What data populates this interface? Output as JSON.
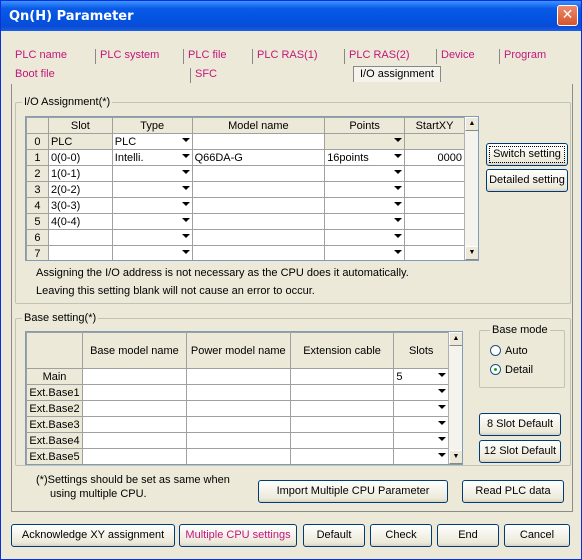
{
  "window": {
    "title": "Qn(H) Parameter",
    "close_glyph": "✕"
  },
  "tabs": {
    "row1": [
      "PLC name",
      "PLC system",
      "PLC file",
      "PLC RAS(1)",
      "PLC RAS(2)",
      "Device",
      "Program"
    ],
    "row2": [
      "Boot file",
      "SFC",
      "I/O assignment"
    ],
    "selected": "I/O assignment"
  },
  "io": {
    "legend": "I/O Assignment(*)",
    "headers": [
      "Slot",
      "Type",
      "Model name",
      "Points",
      "StartXY"
    ],
    "rows": [
      {
        "no": "0",
        "slot": "PLC",
        "type": "PLC",
        "model": "",
        "points": "",
        "start": ""
      },
      {
        "no": "1",
        "slot": "0(0-0)",
        "type": "Intelli.",
        "model": "Q66DA-G",
        "points": "16points",
        "start": "0000"
      },
      {
        "no": "2",
        "slot": "1(0-1)",
        "type": "",
        "model": "",
        "points": "",
        "start": ""
      },
      {
        "no": "3",
        "slot": "2(0-2)",
        "type": "",
        "model": "",
        "points": "",
        "start": ""
      },
      {
        "no": "4",
        "slot": "3(0-3)",
        "type": "",
        "model": "",
        "points": "",
        "start": ""
      },
      {
        "no": "5",
        "slot": "4(0-4)",
        "type": "",
        "model": "",
        "points": "",
        "start": ""
      },
      {
        "no": "6",
        "slot": "",
        "type": "",
        "model": "",
        "points": "",
        "start": ""
      },
      {
        "no": "7",
        "slot": "",
        "type": "",
        "model": "",
        "points": "",
        "start": ""
      }
    ],
    "note1": "Assigning the I/O address is not necessary as the CPU does it automatically.",
    "note2": "Leaving this setting blank will not cause an error to occur.",
    "switch_btn": "Switch setting",
    "detailed_btn": "Detailed setting"
  },
  "base": {
    "legend": "Base setting(*)",
    "headers": [
      "Base model name",
      "Power model name",
      "Extension cable",
      "Slots"
    ],
    "rows": [
      {
        "name": "Main",
        "slots": "5"
      },
      {
        "name": "Ext.Base1",
        "slots": ""
      },
      {
        "name": "Ext.Base2",
        "slots": ""
      },
      {
        "name": "Ext.Base3",
        "slots": ""
      },
      {
        "name": "Ext.Base4",
        "slots": ""
      },
      {
        "name": "Ext.Base5",
        "slots": ""
      }
    ],
    "mode_legend": "Base mode",
    "mode_auto": "Auto",
    "mode_detail": "Detail",
    "selected_mode": "Detail",
    "slot8_btn": "8 Slot Default",
    "slot12_btn": "12 Slot Default"
  },
  "footnote": {
    "line1": "(*)Settings should be set as same when",
    "line2": "using multiple CPU."
  },
  "mid_buttons": {
    "import": "Import Multiple CPU Parameter",
    "read": "Read PLC data"
  },
  "bottom_buttons": {
    "ack": "Acknowledge XY assignment",
    "multi": "Multiple CPU settings",
    "default": "Default",
    "check": "Check",
    "end": "End",
    "cancel": "Cancel"
  },
  "colors": {
    "tab_text": "#c2167c",
    "title_bar": "#0352e0",
    "close": "#d6542d"
  }
}
